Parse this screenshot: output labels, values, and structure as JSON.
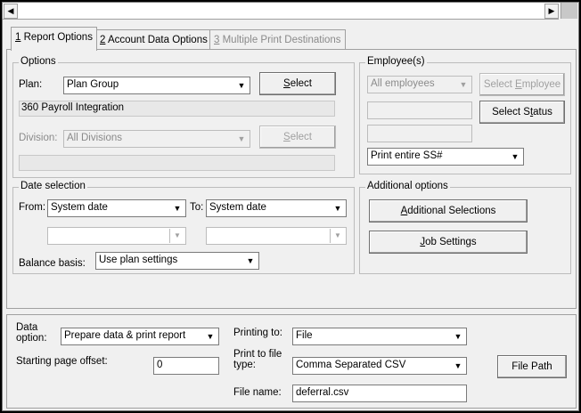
{
  "tabs": [
    {
      "num": "1",
      "label": " Report Options"
    },
    {
      "num": "2",
      "label": " Account Data Options"
    },
    {
      "num": "3",
      "label": " Multiple Print Destinations"
    }
  ],
  "options": {
    "legend": "Options",
    "plan_label": "Plan:",
    "plan_value": "Plan Group",
    "select_hot": "S",
    "select_rest": "elect",
    "plan_description": "360 Payroll Integration",
    "division_label": "Division:",
    "division_value": "All Divisions"
  },
  "employees": {
    "legend": "Employee(s)",
    "employee_value": "All employees",
    "select_employee_a": "Select ",
    "select_employee_hot": "E",
    "select_employee_b": "mployee",
    "select_status_a": "Select S",
    "select_status_hot": "t",
    "select_status_b": "atus",
    "ssn_value": "Print entire SS#"
  },
  "date": {
    "legend": "Date selection",
    "from_label": "From:",
    "from_value": "System date",
    "to_label": "To:",
    "to_value": "System date",
    "balance_label": "Balance basis:",
    "balance_value": "Use plan settings"
  },
  "additional": {
    "legend": "Additional options",
    "addl_hot": "A",
    "addl_rest": "dditional Selections",
    "job_hot": "J",
    "job_rest": "ob Settings"
  },
  "output": {
    "data_option_label_1": "Data",
    "data_option_label_2": "option:",
    "data_option_value": "Prepare data & print report",
    "offset_label": "Starting page offset:",
    "offset_value": "0",
    "printing_to_label": "Printing to:",
    "printing_to_value": "File",
    "print_to_file_label_1": "Print to file",
    "print_to_file_label_2": "type:",
    "file_type_value": "Comma Separated CSV",
    "file_name_label": "File name:",
    "file_name_value": "deferral.csv",
    "file_path_label": "File Path"
  },
  "icons": {
    "scroll_left": "◀",
    "scroll_right": "▶",
    "dropdown": "▼"
  }
}
